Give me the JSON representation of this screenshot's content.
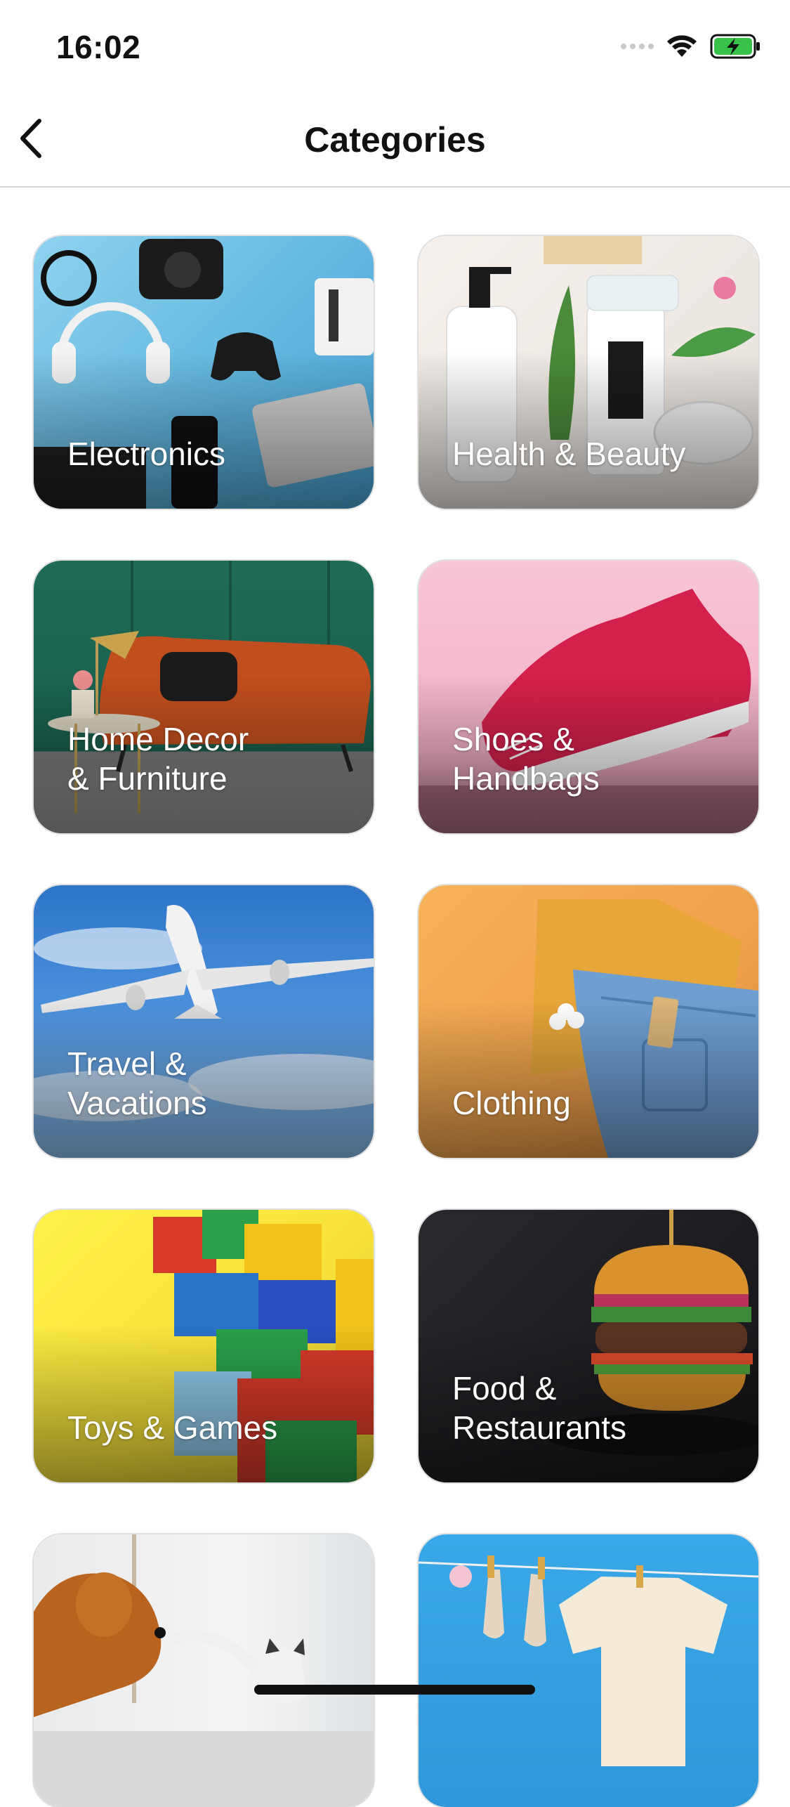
{
  "status_bar": {
    "time": "16:02"
  },
  "nav": {
    "title": "Categories",
    "back_icon": "chevron-left-icon"
  },
  "categories": [
    {
      "label": "Electronics"
    },
    {
      "label": "Health & Beauty"
    },
    {
      "label": "Home Decor\n& Furniture"
    },
    {
      "label": "Shoes &\nHandbags"
    },
    {
      "label": "Travel &\nVacations"
    },
    {
      "label": "Clothing"
    },
    {
      "label": "Toys & Games"
    },
    {
      "label": "Food &\nRestaurants"
    },
    {
      "label": ""
    },
    {
      "label": ""
    }
  ],
  "colors": {
    "battery": "#39c24a",
    "text": "#111111",
    "divider": "#d9d9d9"
  }
}
